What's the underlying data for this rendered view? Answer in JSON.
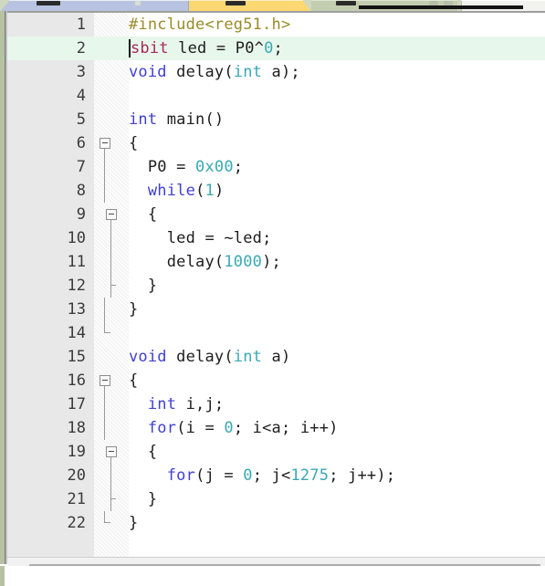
{
  "window": {
    "title": "Keil uVision Code Editor",
    "tabs": [
      {
        "name": "tab-left",
        "label": ""
      },
      {
        "name": "tab-active",
        "label": ""
      },
      {
        "name": "tab-right",
        "label": ""
      },
      {
        "name": "tab-far",
        "label": ""
      }
    ]
  },
  "editor": {
    "language": "C",
    "current_line": 2,
    "cursor_column": 1,
    "total_lines": 22,
    "colors": {
      "background": "#ffffff",
      "gutter": "#e8e8e8",
      "current_line_highlight": "#e8f7ec",
      "preprocessor": "#9a8b2a",
      "keyword": "#4040d0",
      "keyword_special": "#a52a5a",
      "type": "#3aa8b4",
      "number": "#3aa8b4",
      "text": "#1d1d1d"
    },
    "lines": [
      {
        "n": "1",
        "fold": "none",
        "tokens": [
          {
            "t": "#include<reg51.h>",
            "c": "pre"
          }
        ]
      },
      {
        "n": "2",
        "fold": "none",
        "current": true,
        "tokens": [
          {
            "t": "sbit",
            "c": "kw2"
          },
          {
            "t": " led = ",
            "c": "id"
          },
          {
            "t": "P0",
            "c": "id"
          },
          {
            "t": "^",
            "c": "punct"
          },
          {
            "t": "0",
            "c": "num"
          },
          {
            "t": ";",
            "c": "punct"
          }
        ]
      },
      {
        "n": "3",
        "fold": "none",
        "tokens": [
          {
            "t": "void",
            "c": "kw"
          },
          {
            "t": " delay(",
            "c": "id"
          },
          {
            "t": "int",
            "c": "type"
          },
          {
            "t": " a);",
            "c": "id"
          }
        ]
      },
      {
        "n": "4",
        "fold": "none",
        "tokens": []
      },
      {
        "n": "5",
        "fold": "none",
        "tokens": [
          {
            "t": "int",
            "c": "kw"
          },
          {
            "t": " main()",
            "c": "id"
          }
        ]
      },
      {
        "n": "6",
        "fold": "box",
        "tokens": [
          {
            "t": "{",
            "c": "punct"
          }
        ]
      },
      {
        "n": "7",
        "fold": "line",
        "tokens": [
          {
            "t": "  P0 = ",
            "c": "id"
          },
          {
            "t": "0x00",
            "c": "num"
          },
          {
            "t": ";",
            "c": "punct"
          }
        ]
      },
      {
        "n": "8",
        "fold": "line",
        "tokens": [
          {
            "t": "  ",
            "c": "id"
          },
          {
            "t": "while",
            "c": "kw"
          },
          {
            "t": "(",
            "c": "punct"
          },
          {
            "t": "1",
            "c": "num"
          },
          {
            "t": ")",
            "c": "punct"
          }
        ]
      },
      {
        "n": "9",
        "fold": "box-inner",
        "tokens": [
          {
            "t": "  {",
            "c": "punct"
          }
        ]
      },
      {
        "n": "10",
        "fold": "line-inner",
        "tokens": [
          {
            "t": "    led = ~led;",
            "c": "id"
          }
        ]
      },
      {
        "n": "11",
        "fold": "line-inner",
        "tokens": [
          {
            "t": "    delay(",
            "c": "id"
          },
          {
            "t": "1000",
            "c": "num"
          },
          {
            "t": ");",
            "c": "punct"
          }
        ]
      },
      {
        "n": "12",
        "fold": "tick-inner",
        "tokens": [
          {
            "t": "  }",
            "c": "punct"
          }
        ]
      },
      {
        "n": "13",
        "fold": "line",
        "tokens": [
          {
            "t": "}",
            "c": "punct"
          }
        ]
      },
      {
        "n": "14",
        "fold": "end",
        "tokens": []
      },
      {
        "n": "15",
        "fold": "none",
        "tokens": [
          {
            "t": "void",
            "c": "kw"
          },
          {
            "t": " delay(",
            "c": "id"
          },
          {
            "t": "int",
            "c": "type"
          },
          {
            "t": " a)",
            "c": "id"
          }
        ]
      },
      {
        "n": "16",
        "fold": "box",
        "tokens": [
          {
            "t": "{",
            "c": "punct"
          }
        ]
      },
      {
        "n": "17",
        "fold": "line",
        "tokens": [
          {
            "t": "  ",
            "c": "id"
          },
          {
            "t": "int",
            "c": "kw"
          },
          {
            "t": " i,j;",
            "c": "id"
          }
        ]
      },
      {
        "n": "18",
        "fold": "line",
        "tokens": [
          {
            "t": "  ",
            "c": "id"
          },
          {
            "t": "for",
            "c": "kw"
          },
          {
            "t": "(i = ",
            "c": "id"
          },
          {
            "t": "0",
            "c": "num"
          },
          {
            "t": "; i<a; i++)",
            "c": "id"
          }
        ]
      },
      {
        "n": "19",
        "fold": "box-inner",
        "tokens": [
          {
            "t": "  {",
            "c": "punct"
          }
        ]
      },
      {
        "n": "20",
        "fold": "line-inner",
        "tokens": [
          {
            "t": "    ",
            "c": "id"
          },
          {
            "t": "for",
            "c": "kw"
          },
          {
            "t": "(j = ",
            "c": "id"
          },
          {
            "t": "0",
            "c": "num"
          },
          {
            "t": "; j<",
            "c": "id"
          },
          {
            "t": "1275",
            "c": "num"
          },
          {
            "t": "; j++);",
            "c": "id"
          }
        ]
      },
      {
        "n": "21",
        "fold": "tick-inner",
        "tokens": [
          {
            "t": "  }",
            "c": "punct"
          }
        ]
      },
      {
        "n": "22",
        "fold": "end",
        "tokens": [
          {
            "t": "}",
            "c": "punct"
          }
        ]
      }
    ]
  },
  "scrollbar": {
    "orientation": "horizontal",
    "position": 0
  }
}
